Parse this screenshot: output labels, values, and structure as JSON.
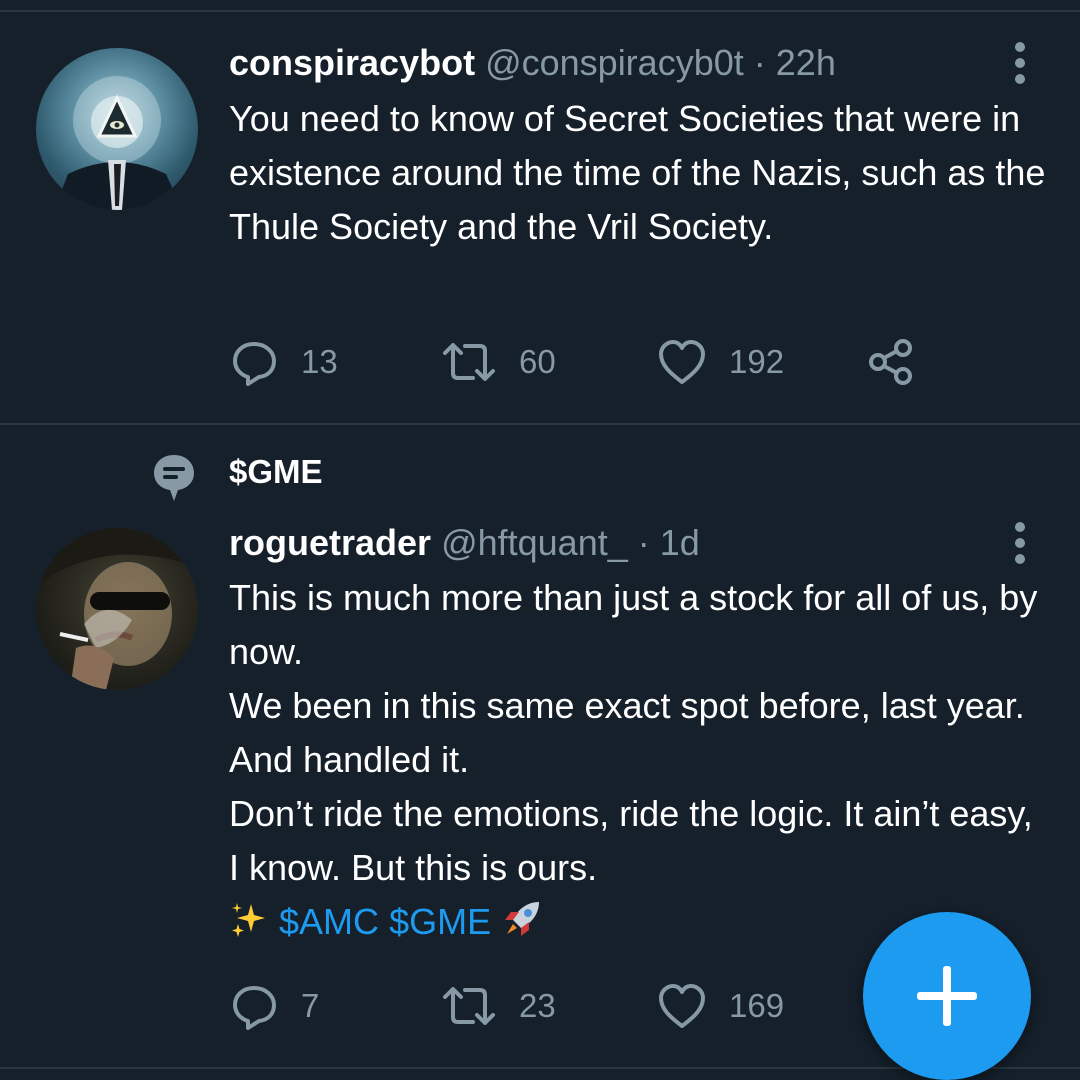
{
  "tweets": [
    {
      "display_name": "conspiracybot",
      "handle": "@conspiracyb0t",
      "separator": "·",
      "time": "22h",
      "text_lines": [
        "You need to know of Secret Societies that were in existence around the time of the Nazis, such as the Thule Society and the Vril Society."
      ],
      "counts": {
        "replies": "13",
        "retweets": "60",
        "likes": "192"
      }
    },
    {
      "topic": "$GME",
      "display_name": "roguetrader",
      "handle": "@hftquant_",
      "separator": "·",
      "time": "1d",
      "text_lines": [
        "This is much more than just a stock for all of us, by now.",
        "We been in this same exact spot before, last year. And handled it.",
        "Don’t ride the emotions, ride the logic. It ain’t easy, I know. But this is ours."
      ],
      "hashtags": [
        "$AMC",
        "$GME"
      ],
      "emojis": [
        "sparkles-icon",
        "rocket-icon"
      ],
      "counts": {
        "replies": "7",
        "retweets": "23",
        "likes": "169"
      }
    }
  ],
  "colors": {
    "background": "#15202b",
    "divider": "#2b3641",
    "secondary_text": "#8899a6",
    "accent": "#1d9bf0"
  },
  "fab_icon": "plus-icon"
}
